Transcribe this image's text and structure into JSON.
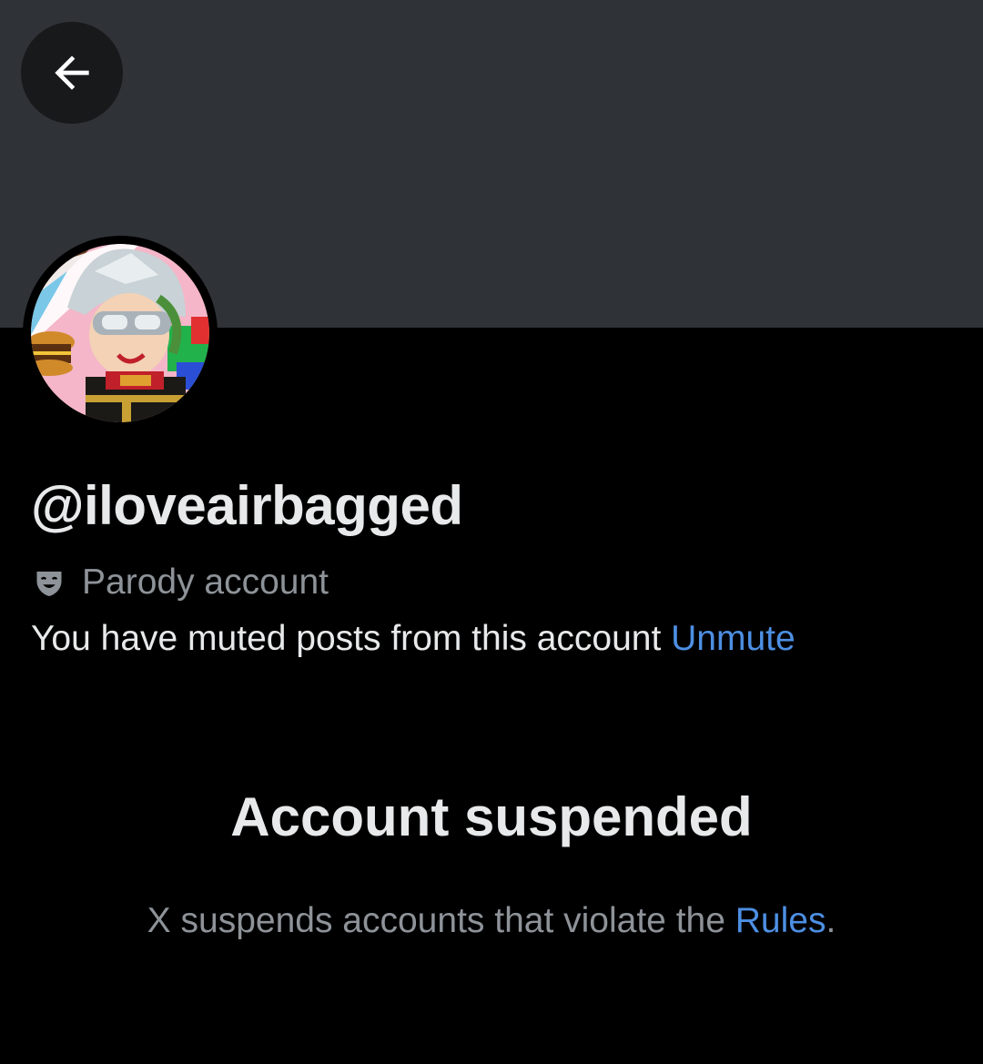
{
  "header": {
    "back_icon": "arrow-left-icon",
    "banner_color": "#2f3236"
  },
  "profile": {
    "avatar_icon": "profile-avatar",
    "handle": "@iloveairbagged",
    "parody_icon": "theater-masks-icon",
    "parody_label": "Parody account",
    "muted_text": "You have muted posts from this account",
    "unmute_label": "Unmute"
  },
  "suspension": {
    "title": "Account suspended",
    "description_prefix": "X suspends accounts that violate the",
    "rules_link": "Rules",
    "description_suffix": "."
  },
  "colors": {
    "background": "#000000",
    "link": "#4d8fe3",
    "primary_text": "#e7e9ea",
    "secondary_text": "#8e9399"
  }
}
